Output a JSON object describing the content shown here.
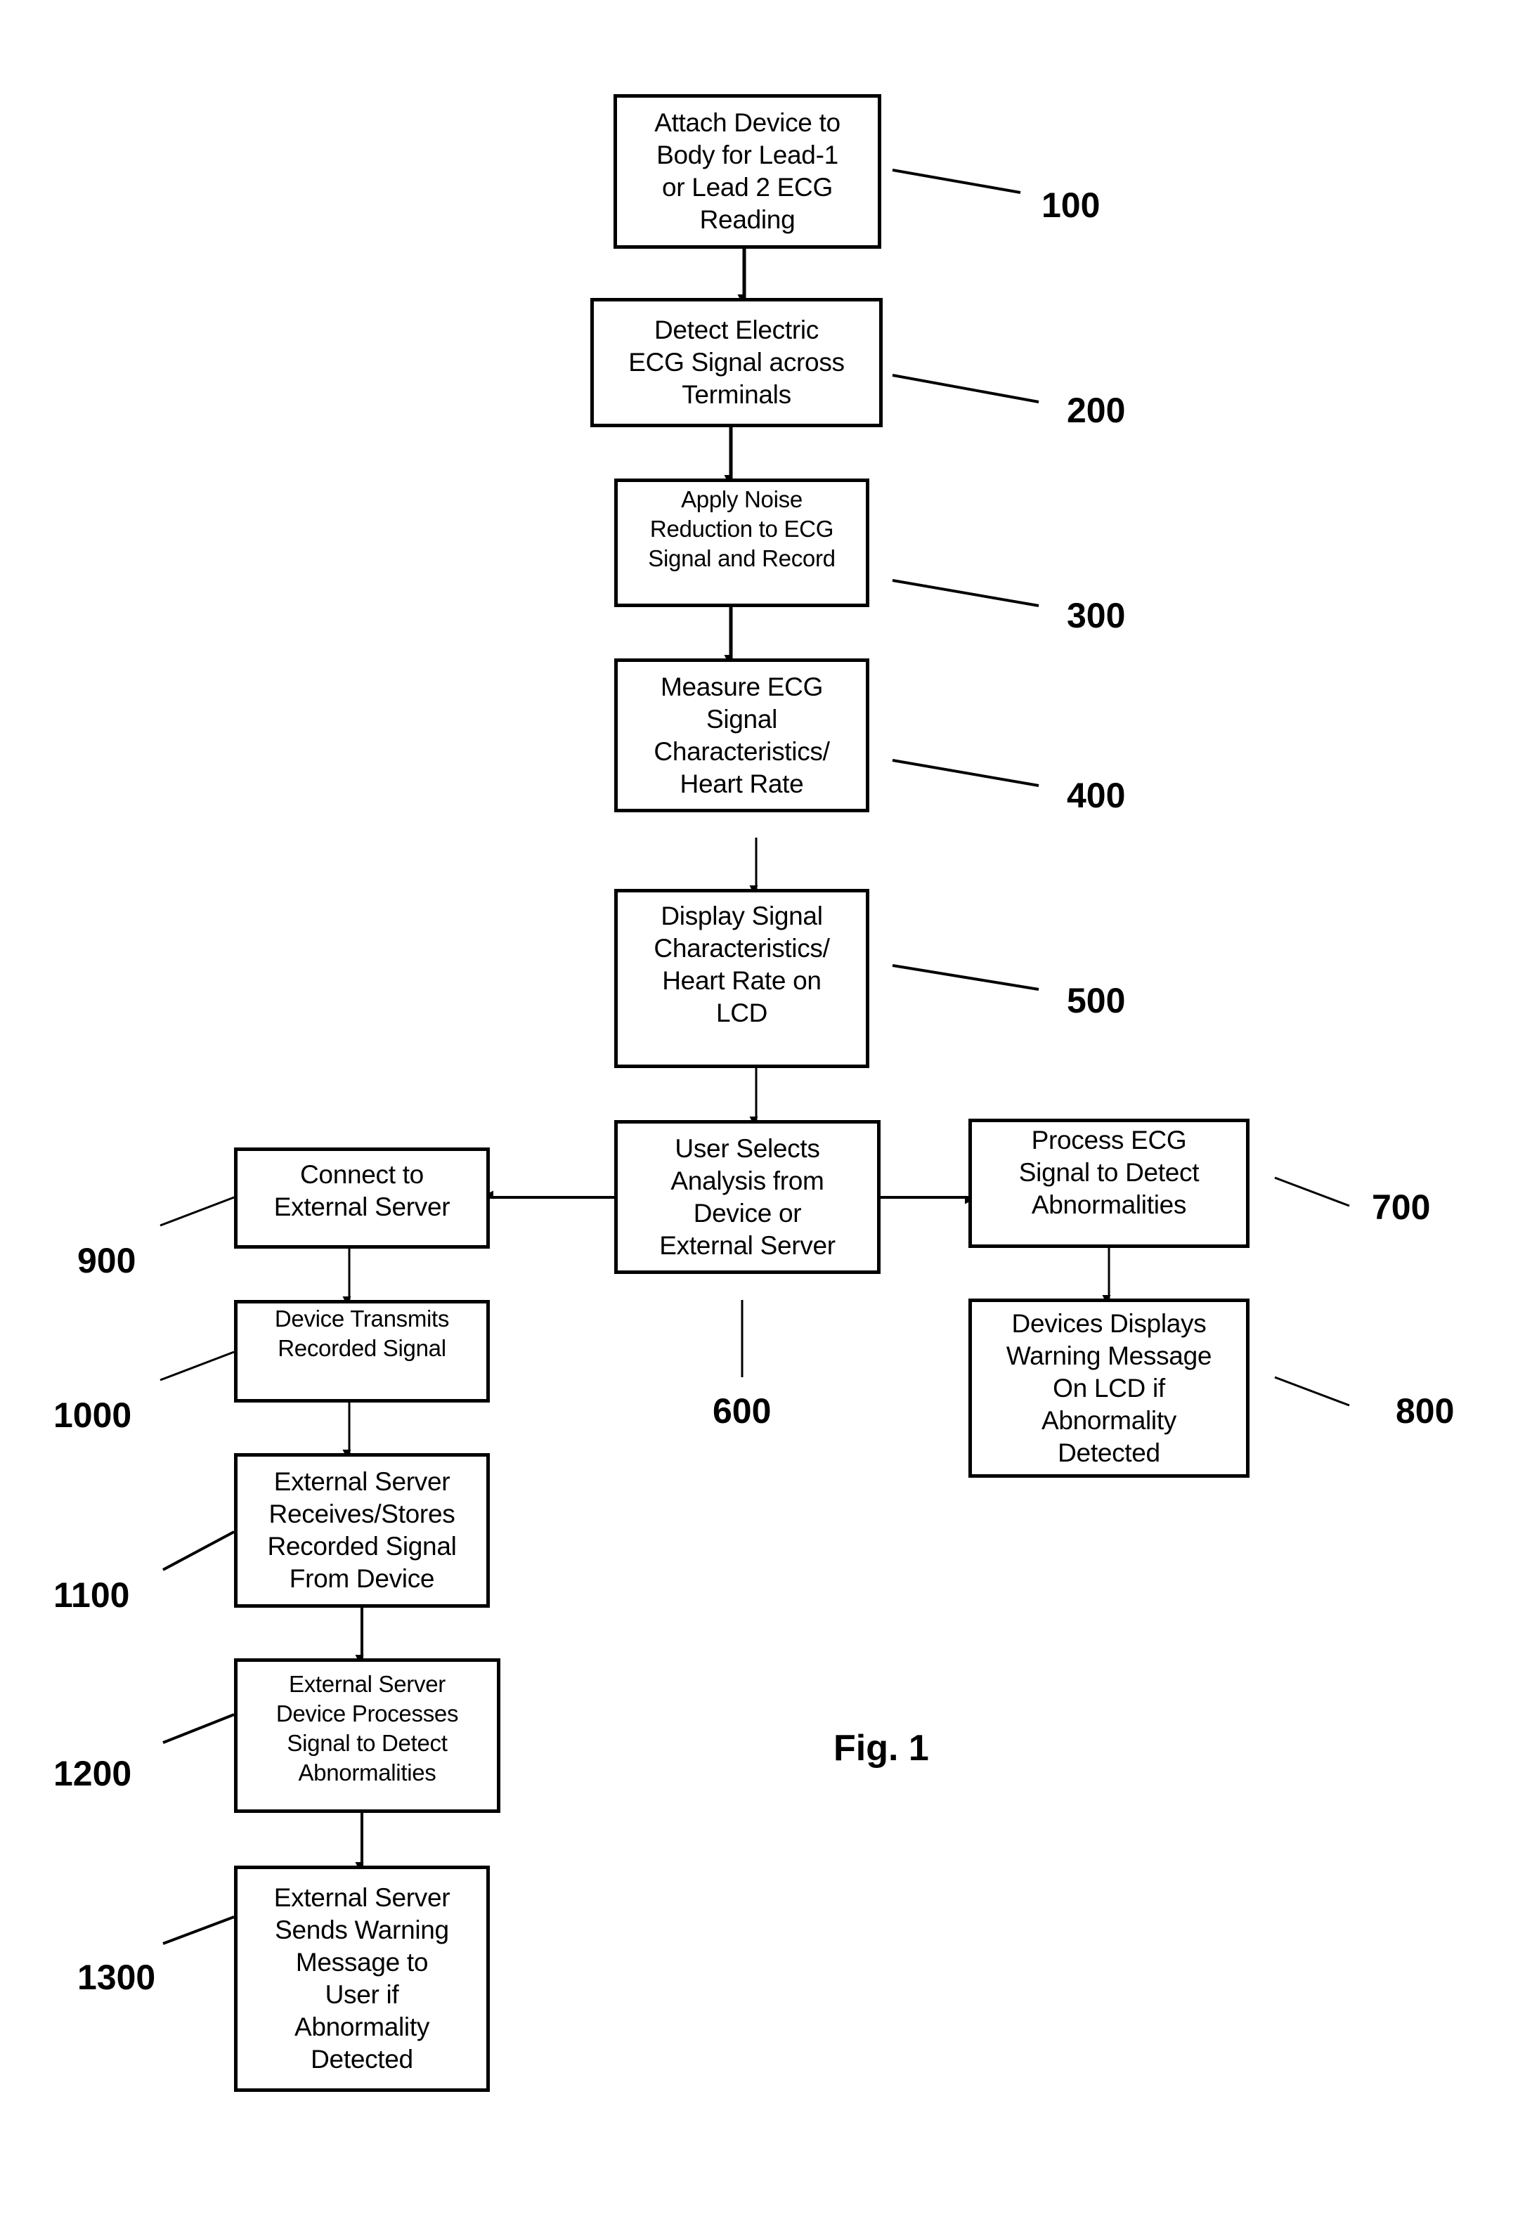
{
  "figure_label": "Fig. 1",
  "steps": {
    "s100": {
      "ref": "100",
      "text": "Attach Device to\nBody for Lead-1\nor Lead 2 ECG\nReading"
    },
    "s200": {
      "ref": "200",
      "text": "Detect Electric\nECG Signal across\nTerminals"
    },
    "s300": {
      "ref": "300",
      "text": "Apply Noise\nReduction to ECG\nSignal and Record"
    },
    "s400": {
      "ref": "400",
      "text": "Measure ECG\nSignal\nCharacteristics/\nHeart Rate"
    },
    "s500": {
      "ref": "500",
      "text": "Display Signal\nCharacteristics/\nHeart Rate on\nLCD"
    },
    "s600": {
      "ref": "600",
      "text": "User Selects\nAnalysis from\nDevice or\nExternal Server"
    },
    "s700": {
      "ref": "700",
      "text": "Process ECG\nSignal to Detect\nAbnormalities"
    },
    "s800": {
      "ref": "800",
      "text": "Devices Displays\nWarning Message\nOn LCD if\nAbnormality\nDetected"
    },
    "s900": {
      "ref": "900",
      "text": "Connect to\nExternal Server"
    },
    "s1000": {
      "ref": "1000",
      "text": "Device Transmits\nRecorded Signal"
    },
    "s1100": {
      "ref": "1100",
      "text": "External Server\nReceives/Stores\nRecorded Signal\nFrom Device"
    },
    "s1200": {
      "ref": "1200",
      "text": "External Server\nDevice Processes\nSignal to Detect\nAbnormalities"
    },
    "s1300": {
      "ref": "1300",
      "text": "External Server\nSends Warning\nMessage to\nUser if\nAbnormality\nDetected"
    }
  },
  "flow": [
    [
      "s100",
      "s200"
    ],
    [
      "s200",
      "s300"
    ],
    [
      "s300",
      "s400"
    ],
    [
      "s400",
      "s500"
    ],
    [
      "s500",
      "s600"
    ],
    [
      "s600",
      "s700"
    ],
    [
      "s700",
      "s800"
    ],
    [
      "s600",
      "s900"
    ],
    [
      "s900",
      "s1000"
    ],
    [
      "s1000",
      "s1100"
    ],
    [
      "s1100",
      "s1200"
    ],
    [
      "s1200",
      "s1300"
    ]
  ]
}
